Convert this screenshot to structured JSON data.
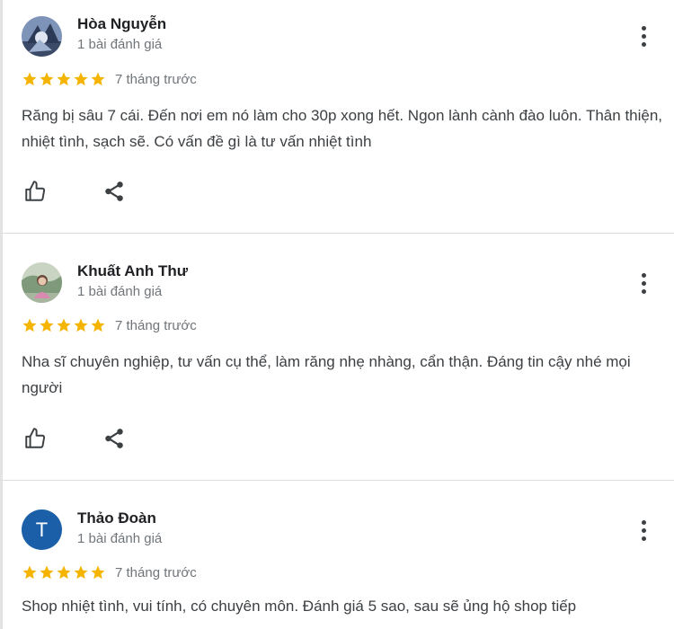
{
  "colors": {
    "star": "#f4b400",
    "avatar_letter_bg": "#1a5fa8",
    "divider": "#dadce0"
  },
  "reviews": [
    {
      "avatar_type": "photo",
      "name": "Hòa Nguyễn",
      "review_count": "1 bài đánh giá",
      "rating": 5,
      "time": "7 tháng trước",
      "text": "Răng bị sâu 7 cái. Đến nơi em nó làm cho 30p xong hết. Ngon lành cành đào luôn. Thân thiện, nhiệt tình, sạch sẽ. Có vấn đề gì là tư vấn nhiệt tình",
      "like_icon": "thumbs-up-icon",
      "share_icon": "share-icon",
      "menu_icon": "more-vert-icon"
    },
    {
      "avatar_type": "photo",
      "name": "Khuất Anh Thư",
      "review_count": "1 bài đánh giá",
      "rating": 5,
      "time": "7 tháng trước",
      "text": "Nha sĩ chuyên nghiệp, tư vấn cụ thể, làm răng nhẹ nhàng, cẩn thận. Đáng tin cậy nhé mọi người",
      "like_icon": "thumbs-up-icon",
      "share_icon": "share-icon",
      "menu_icon": "more-vert-icon"
    },
    {
      "avatar_type": "letter",
      "avatar_letter": "T",
      "name": "Thảo Đoàn",
      "review_count": "1 bài đánh giá",
      "rating": 5,
      "time": "7 tháng trước",
      "text": "Shop nhiệt tình, vui tính, có chuyên môn. Đánh giá 5 sao, sau sẽ ủng hộ shop tiếp",
      "menu_icon": "more-vert-icon"
    }
  ]
}
